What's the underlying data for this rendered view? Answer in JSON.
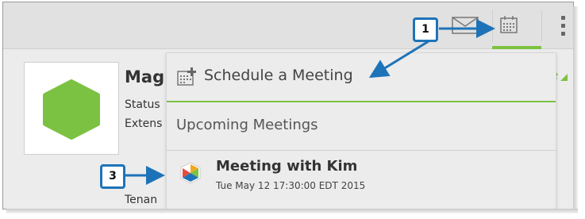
{
  "toolbar": {
    "icons": [
      "mail-icon",
      "calendar-icon",
      "overflow-menu-icon"
    ],
    "accent_color": "#7cc242"
  },
  "profile": {
    "name": "Mag",
    "status_label": "Status",
    "extension_label": "Extens",
    "tenant_label": "Tenan"
  },
  "dropdown": {
    "schedule_label": "Schedule a Meeting",
    "upcoming_label": "Upcoming Meetings",
    "meeting": {
      "title": "Meeting with Kim",
      "time": "Tue May 12 17:30:00 EDT 2015"
    }
  },
  "callouts": {
    "one": "1",
    "three": "3"
  },
  "colors": {
    "accent": "#7cc242",
    "callout_border": "#1e73b8"
  }
}
